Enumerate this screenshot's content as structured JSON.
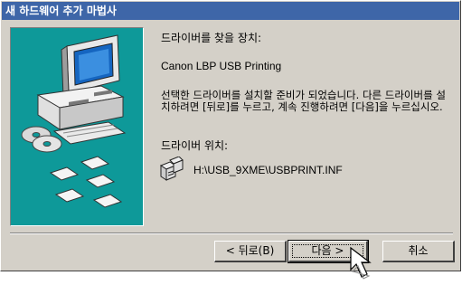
{
  "window": {
    "title": "새 하드웨어 추가 마법사"
  },
  "content": {
    "device_label": "드라이버를 찾을 장치:",
    "device_name": "Canon LBP USB Printing",
    "instruction": "선택한 드라이버를 설치할 준비가 되었습니다. 다른 드라이버를 설치하려면 [뒤로]를 누르고, 계속 진행하려면 [다음]을 누르십시오.",
    "location_label": "드라이버 위치:",
    "driver_path": "H:\\USB_9XME\\USBPRINT.INF"
  },
  "buttons": {
    "back": "< 뒤로(B)",
    "next": "다음 >",
    "cancel": "취소"
  },
  "colors": {
    "title_bar": "#3e66a8",
    "panel": "#0e9999",
    "dialog": "#d4d0c8"
  },
  "icons": [
    "computer-icon",
    "cd-icon",
    "floppy-icon",
    "driver-file-icon",
    "pointer-cursor-icon"
  ]
}
